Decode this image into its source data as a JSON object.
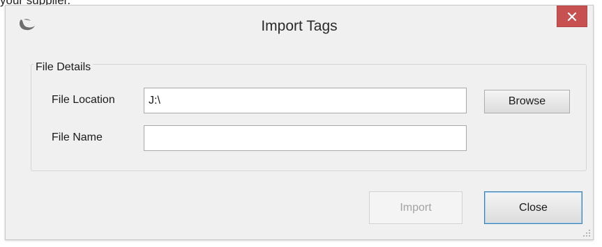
{
  "background_text": "your supplier.",
  "window": {
    "title": "Import Tags",
    "close_glyph": "✕",
    "app_icon": "moon-logo-icon"
  },
  "group": {
    "legend": "File Details",
    "file_location": {
      "label": "File Location",
      "value": "J:\\",
      "placeholder": ""
    },
    "file_name": {
      "label": "File Name",
      "value": "",
      "placeholder": ""
    },
    "browse_label": "Browse"
  },
  "footer": {
    "import_label": "Import",
    "import_enabled": false,
    "close_label": "Close"
  },
  "colors": {
    "window_bg": "#f0f0f0",
    "close_button": "#c75050",
    "default_button_border": "#3c7fb1"
  }
}
